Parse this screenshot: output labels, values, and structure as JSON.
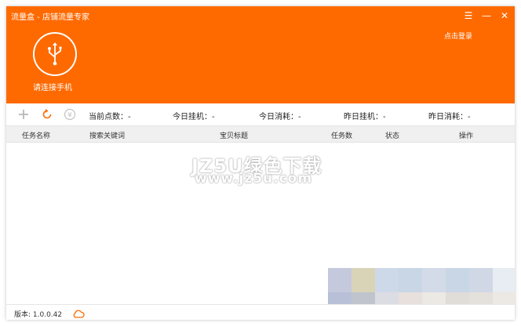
{
  "window": {
    "title": "流量盒 - 店铺流量专家"
  },
  "header": {
    "login_label": "点击登录",
    "connect_label": "请连接手机",
    "accent_color": "#ff6a00"
  },
  "toolbar": {
    "icons": [
      "add-icon",
      "refresh-icon",
      "yen-icon"
    ],
    "stats": [
      {
        "label": "当前点数：-"
      },
      {
        "label": "今日挂机：-"
      },
      {
        "label": "今日消耗：-"
      },
      {
        "label": "昨日挂机：-"
      },
      {
        "label": "昨日消耗：-"
      }
    ]
  },
  "table": {
    "columns": [
      "任务名称",
      "搜索关键词",
      "宝贝标题",
      "任务数",
      "状态",
      "操作"
    ],
    "rows": []
  },
  "watermark": {
    "title": "JZ5U绿色下载",
    "url": "www.jz5u.com"
  },
  "footer": {
    "version": "版本: 1.0.0.42"
  },
  "mosaic_colors": [
    "#c5c9dd",
    "#d9d4b8",
    "#cdd9e8",
    "#c9d6e6",
    "#d3dbe8",
    "#c9d6e6",
    "#d0d8e6",
    "#e8edf3",
    "#b8c0d8",
    "#c0c4cc",
    "#dcdce4",
    "#e8e0dc",
    "#ece8e4",
    "#e0dcd8",
    "#e4e0dc",
    "#ece8e4"
  ]
}
